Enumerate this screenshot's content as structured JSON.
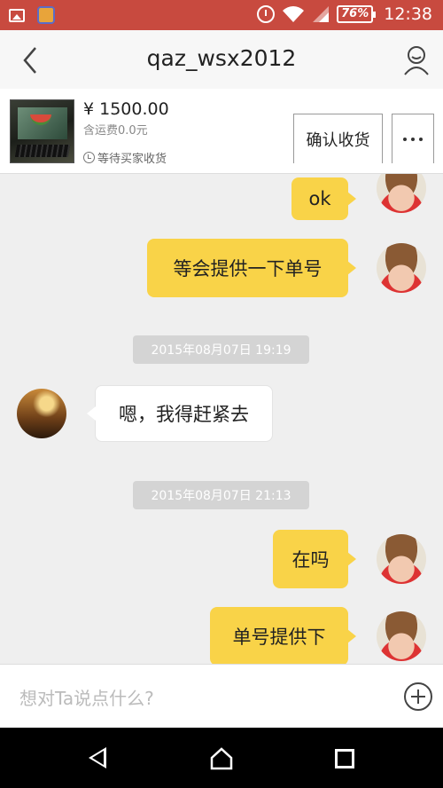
{
  "status_bar": {
    "battery": "76%",
    "time": "12:38",
    "icons": [
      "image-icon",
      "app-icon",
      "alarm-icon",
      "wifi-icon",
      "signal-icon",
      "battery-icon"
    ]
  },
  "header": {
    "title": "qaz_wsx2012",
    "back_icon": "chevron-left-icon",
    "profile_icon": "user-profile-icon"
  },
  "product": {
    "price": "¥ 1500.00",
    "shipping": "含运费0.0元",
    "status": "等待买家收货",
    "confirm_label": "确认收货",
    "more_icon": "more-dots-icon"
  },
  "chat": {
    "messages": [
      {
        "from": "me",
        "text": "ok"
      },
      {
        "from": "me",
        "text": "等会提供一下单号"
      },
      {
        "type": "timestamp",
        "text": "2015年08月07日 19:19"
      },
      {
        "from": "them",
        "text": "嗯，我得赶紧去"
      },
      {
        "type": "timestamp",
        "text": "2015年08月07日 21:13"
      },
      {
        "from": "me",
        "text": "在吗"
      },
      {
        "from": "me",
        "text": "单号提供下"
      }
    ]
  },
  "composer": {
    "placeholder": "想对Ta说点什么?",
    "add_icon": "plus-circle-icon"
  },
  "nav": {
    "icons": [
      "back-triangle-icon",
      "home-icon",
      "recent-apps-icon"
    ]
  },
  "colors": {
    "status_bar": "#c84a3f",
    "my_bubble": "#f9d348",
    "their_bubble": "#ffffff",
    "chat_bg": "#efefef",
    "timestamp_bg": "#d4d4d4"
  }
}
